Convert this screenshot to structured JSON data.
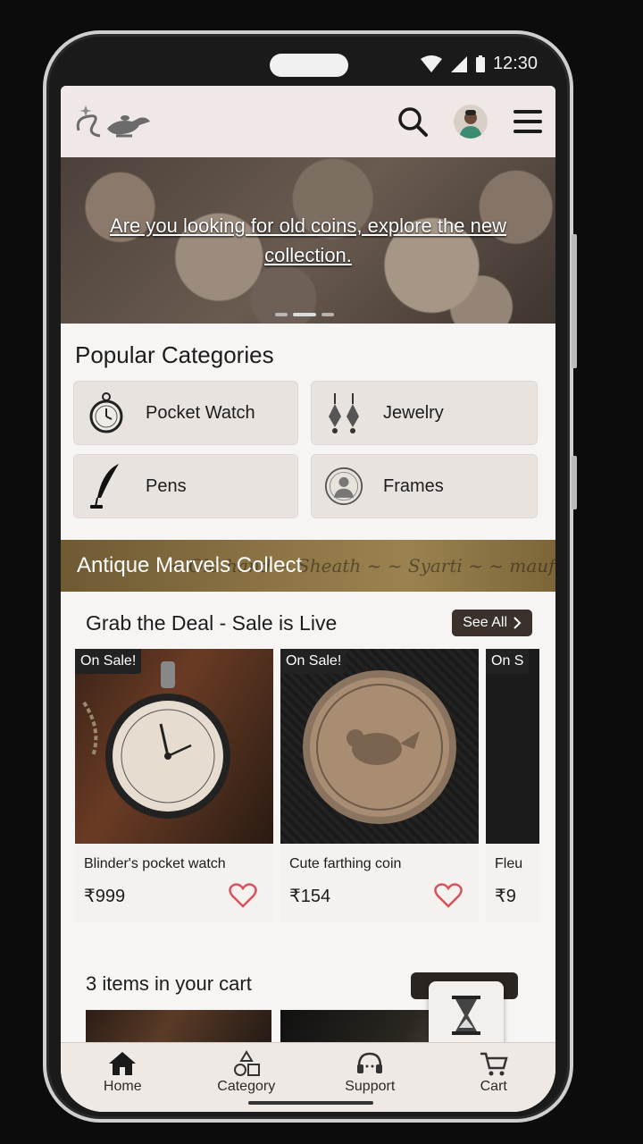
{
  "status_bar": {
    "time": "12:30"
  },
  "header": {
    "logo": "genie-lamp-logo"
  },
  "hero": {
    "text": "Are you looking for old coins, explore the new collection."
  },
  "categories": {
    "title": "Popular Categories",
    "items": [
      {
        "label": "Pocket Watch",
        "icon": "pocket-watch-icon"
      },
      {
        "label": "Jewelry",
        "icon": "earrings-icon"
      },
      {
        "label": "Pens",
        "icon": "quill-pen-icon"
      },
      {
        "label": "Frames",
        "icon": "portrait-frame-icon"
      }
    ]
  },
  "banner": {
    "text": "Antique Marvels Collect"
  },
  "deals": {
    "title": "Grab the Deal - Sale is Live",
    "see_all": "See All",
    "products": [
      {
        "badge": "On Sale!",
        "name": "Blinder's pocket watch",
        "price": "₹999"
      },
      {
        "badge": "On Sale!",
        "name": "Cute farthing coin",
        "price": "₹154"
      },
      {
        "badge": "On S",
        "name": "Fleu",
        "price": "₹9"
      }
    ]
  },
  "cart": {
    "title": "3 items in your cart"
  },
  "nav": {
    "items": [
      {
        "label": "Home",
        "icon": "home-icon"
      },
      {
        "label": "Category",
        "icon": "category-icon"
      },
      {
        "label": "Support",
        "icon": "headset-icon"
      },
      {
        "label": "Cart",
        "icon": "cart-icon"
      }
    ]
  },
  "colors": {
    "accent_dark": "#3a302c",
    "screen_bg": "#f7f5f3",
    "header_bg": "#efe8e6",
    "heart": "#d8525d"
  }
}
